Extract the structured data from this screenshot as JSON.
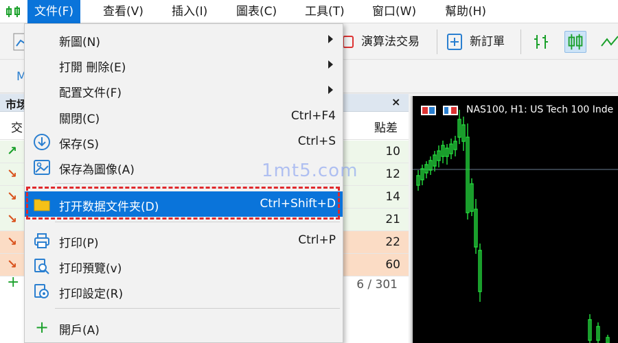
{
  "menubar": {
    "items": [
      "文件(F)",
      "查看(V)",
      "插入(I)",
      "圖表(C)",
      "工具(T)",
      "窗口(W)",
      "幫助(H)"
    ]
  },
  "toolbar": {
    "algo_trading": "演算法交易",
    "new_order": "新訂單",
    "second_row_letter": "M"
  },
  "market_watch": {
    "title": "市场",
    "col_left": "交",
    "col_right": "點差",
    "rows": [
      {
        "dir": "up",
        "value": "10"
      },
      {
        "dir": "down",
        "value": "12"
      },
      {
        "dir": "down",
        "value": "14"
      },
      {
        "dir": "down",
        "value": "21"
      },
      {
        "dir": "down",
        "value": "22"
      },
      {
        "dir": "down",
        "value": "60"
      }
    ],
    "count": "6 / 301",
    "close": "×"
  },
  "chart": {
    "title": "NAS100, H1:  US Tech 100 Inde"
  },
  "file_menu": {
    "items": [
      {
        "label": "新圖(N)",
        "shortcut": "",
        "submenu": true
      },
      {
        "label": "打開 刪除(E)",
        "shortcut": "",
        "submenu": true
      },
      {
        "label": "配置文件(F)",
        "shortcut": "",
        "submenu": true
      },
      {
        "label": "關閉(C)",
        "shortcut": "Ctrl+F4",
        "submenu": false
      },
      {
        "label": "保存(S)",
        "shortcut": "Ctrl+S",
        "submenu": false
      },
      {
        "label": "保存為圖像(A)",
        "shortcut": "",
        "submenu": false
      },
      {
        "label": "打开数据文件夹(D)",
        "shortcut": "Ctrl+Shift+D",
        "submenu": false
      },
      {
        "label": "打印(P)",
        "shortcut": "Ctrl+P",
        "submenu": false
      },
      {
        "label": "打印預覽(v)",
        "shortcut": "",
        "submenu": false
      },
      {
        "label": "打印設定(R)",
        "shortcut": "",
        "submenu": false
      },
      {
        "label": "開戶(A)",
        "shortcut": "",
        "submenu": false
      }
    ]
  },
  "watermark": "1mt5.com",
  "colors": {
    "accent": "#0a74da",
    "highlight_border": "#e0282b",
    "up": "#1aa02a",
    "down": "#d9531e"
  }
}
